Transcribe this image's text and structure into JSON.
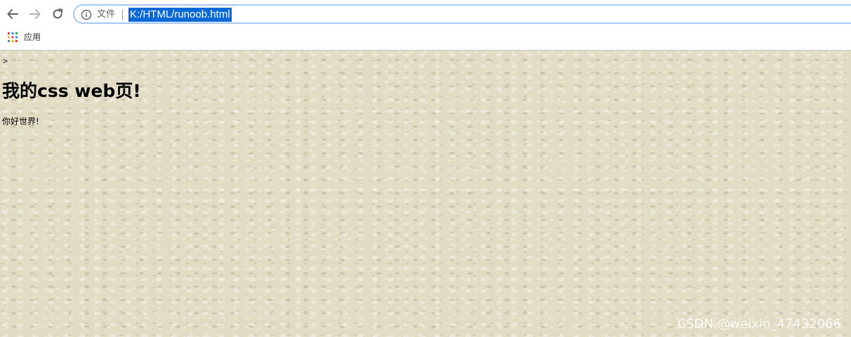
{
  "toolbar": {
    "back_icon": "arrow-left-icon",
    "forward_icon": "arrow-right-icon",
    "reload_icon": "reload-icon",
    "info_icon": "info-circle-icon",
    "file_label": "文件",
    "url": "K:/HTML/runoob.html",
    "selection_color": "#0a68d8"
  },
  "bookmarks": {
    "apps_icon": "apps-grid-icon",
    "apps_label": "应用"
  },
  "page": {
    "stray_text": ">",
    "heading": "我的css web页!",
    "paragraph": "你好世界!",
    "background_color": "#e2dcc4"
  },
  "watermark": "CSDN @weixin_47432066"
}
